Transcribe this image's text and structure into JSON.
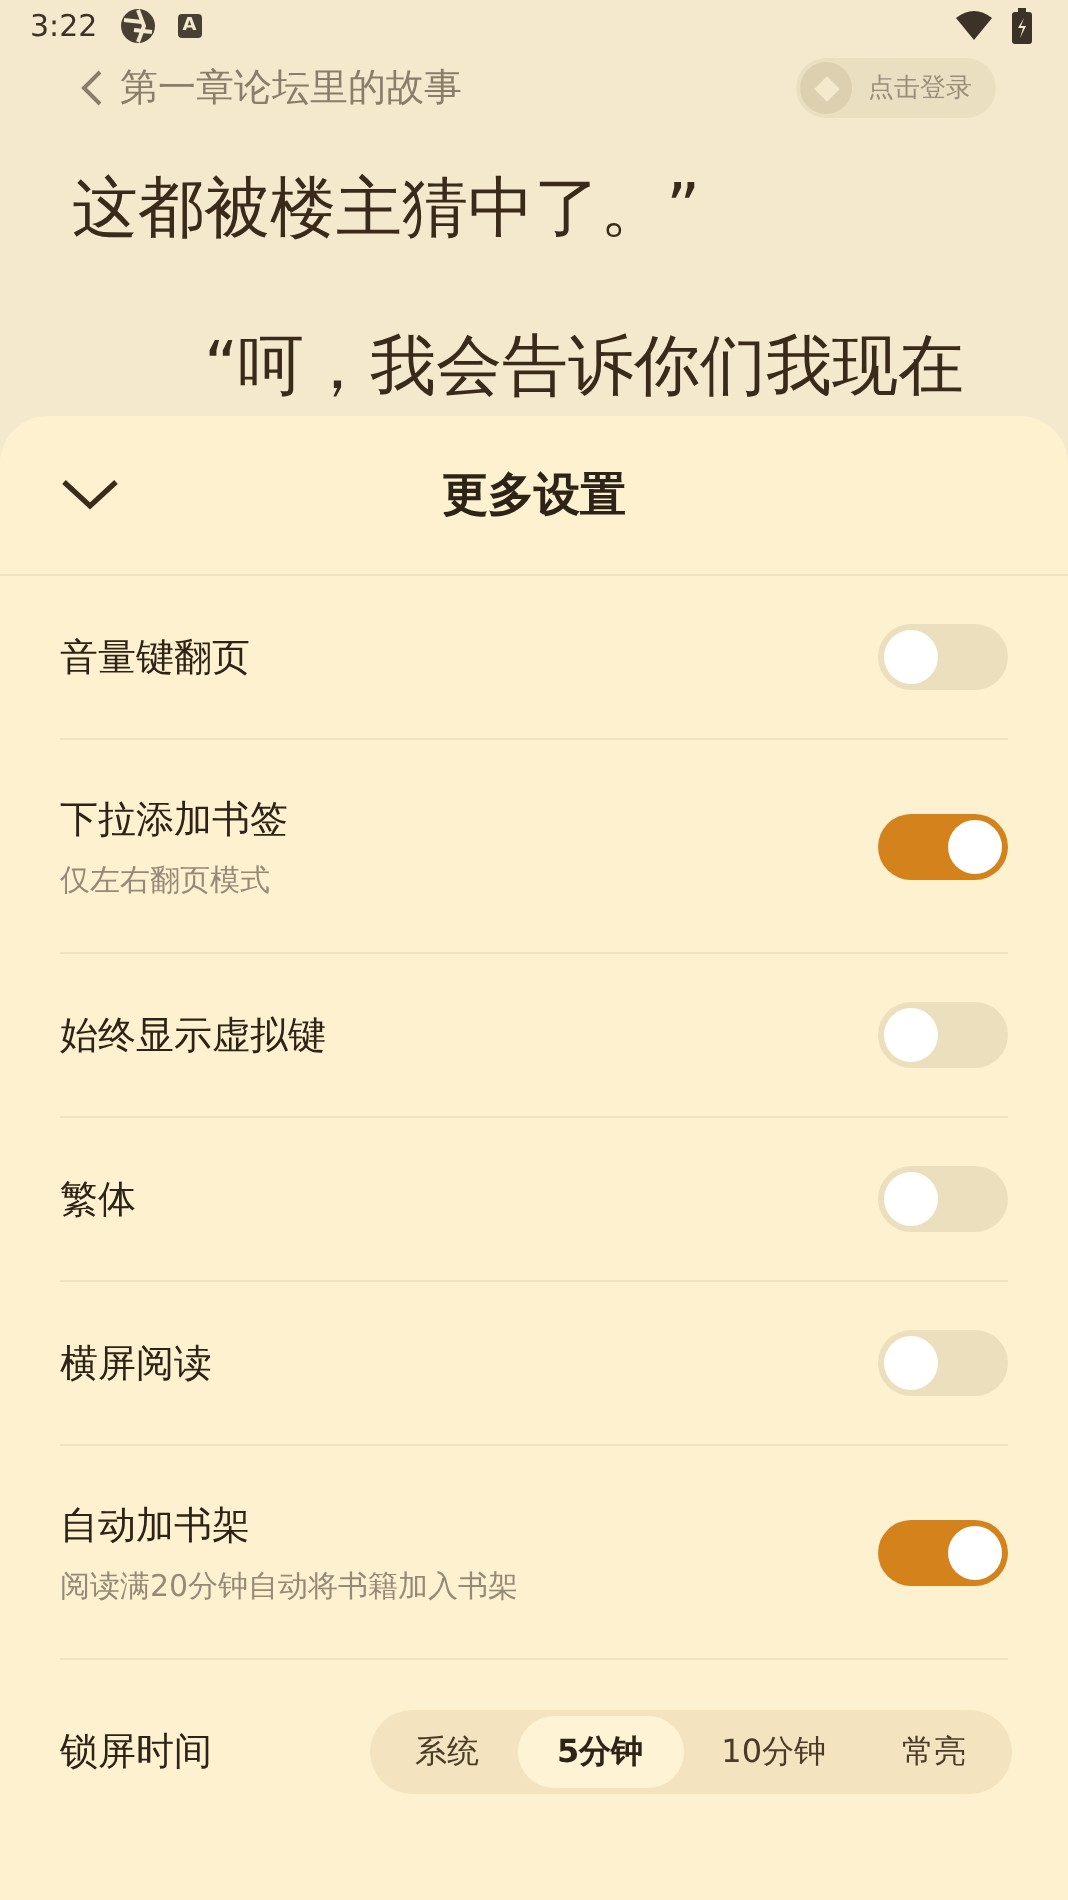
{
  "status_bar": {
    "time": "3:22",
    "notification_badge": "A"
  },
  "reader": {
    "chapter_title": "第一章论坛里的故事",
    "login_button": "点击登录",
    "lines": [
      "这都被楼主猜中了。”",
      "“呵，我会告诉你们我现在"
    ]
  },
  "sheet": {
    "title": "更多设置",
    "settings": [
      {
        "kind": "toggle",
        "label": "音量键翻页",
        "on": false
      },
      {
        "kind": "toggle",
        "label": "下拉添加书签",
        "hint": "仅左右翻页模式",
        "on": true
      },
      {
        "kind": "toggle",
        "label": "始终显示虚拟键",
        "on": false
      },
      {
        "kind": "toggle",
        "label": "繁体",
        "on": false
      },
      {
        "kind": "toggle",
        "label": "横屏阅读",
        "on": false
      },
      {
        "kind": "toggle",
        "label": "自动加书架",
        "hint": "阅读满20分钟自动将书籍加入书架",
        "on": true
      },
      {
        "kind": "segmented",
        "label": "锁屏时间",
        "options": [
          {
            "label": "系统",
            "selected": false
          },
          {
            "label": "5分钟",
            "selected": true
          },
          {
            "label": "10分钟",
            "selected": false
          },
          {
            "label": "常亮",
            "selected": false
          }
        ]
      }
    ]
  }
}
